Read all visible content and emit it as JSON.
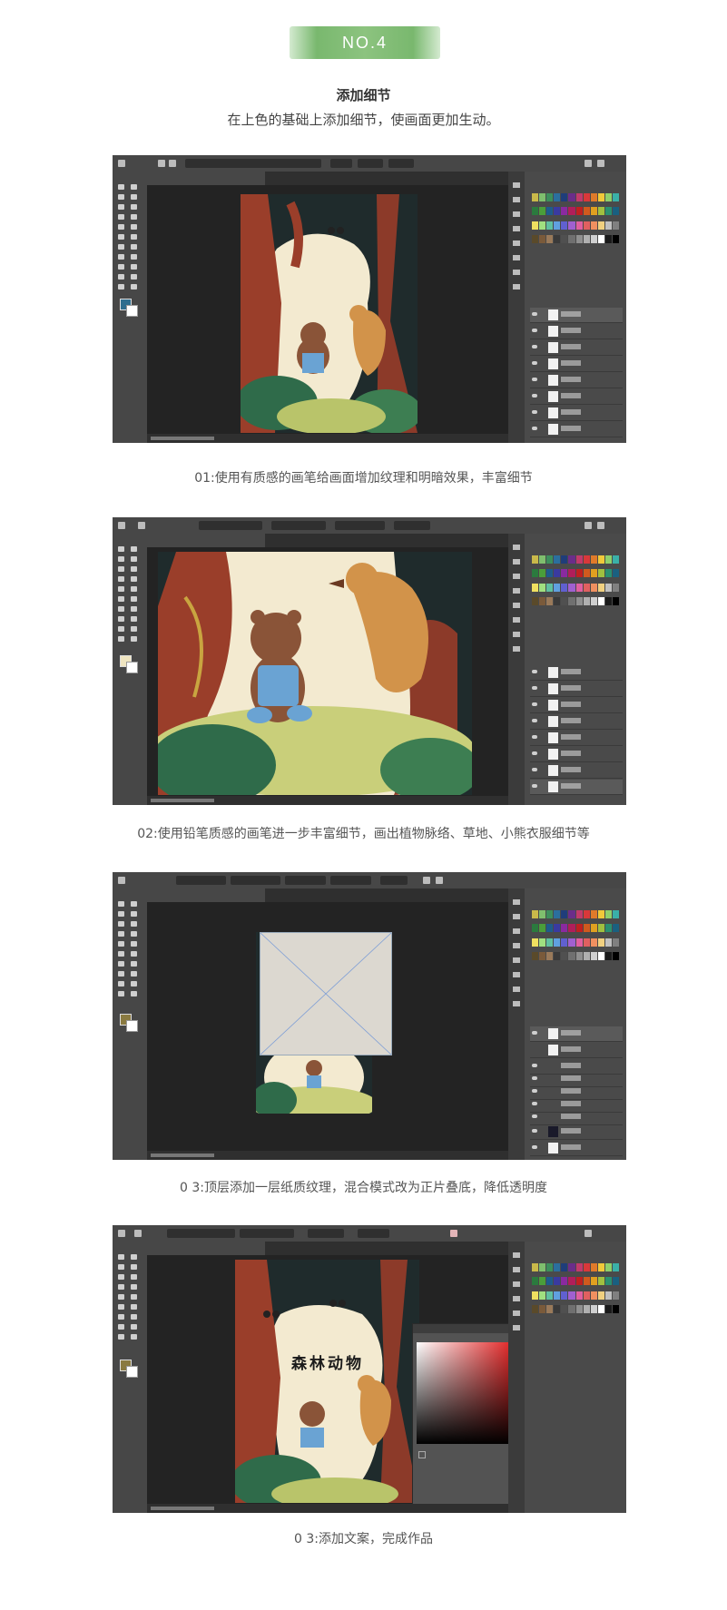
{
  "header": {
    "badge": "NO.4",
    "title": "添加细节",
    "subtitle": "在上色的基础上添加细节，使画面更加生动。"
  },
  "steps": [
    {
      "caption": "01:使用有质感的画笔给画面增加纹理和明暗效果，丰富细节"
    },
    {
      "caption": "02:使用铅笔质感的画笔进一步丰富细节，画出植物脉络、草地、小熊衣服细节等"
    },
    {
      "caption": "0 3:顶层添加一层纸质纹理，混合模式改为正片叠底，降低透明度"
    },
    {
      "caption": "0 3:添加文案，完成作品"
    }
  ],
  "artwork": {
    "title_text": "森林动物"
  },
  "colors": {
    "badge": "#7fbb73",
    "ps_dark": "#232323",
    "ps_mid": "#474747",
    "cream": "#f4ecd2",
    "tree": "#9a3e2a",
    "leaf": "#2f6b4a",
    "bear_brown": "#8a5438",
    "overalls": "#6aa3d3",
    "bird": "#d2934a"
  },
  "icons": [
    "photoshop-home-icon",
    "toolbar-icon",
    "search-icon",
    "eye-icon",
    "lock-icon",
    "color-picker-icon"
  ]
}
